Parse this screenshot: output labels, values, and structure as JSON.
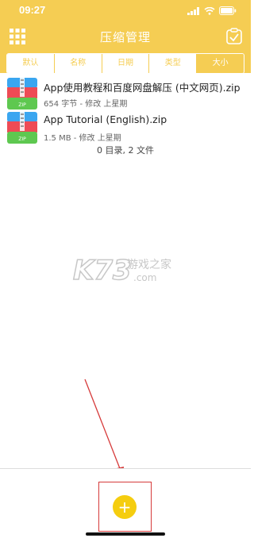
{
  "status_bar": {
    "time": "09:27"
  },
  "header": {
    "title": "压缩管理"
  },
  "sort_tabs": [
    {
      "label": "默认",
      "active": false
    },
    {
      "label": "名称",
      "active": false
    },
    {
      "label": "日期",
      "active": false
    },
    {
      "label": "类型",
      "active": false
    },
    {
      "label": "大小",
      "active": true
    }
  ],
  "files": [
    {
      "name": "App使用教程和百度网盘解压 (中文网页).zip",
      "meta": "654 字节 - 修改 上星期",
      "icon": "zip-file-icon",
      "icon_label": "ZIP"
    },
    {
      "name": "App Tutorial (English).zip",
      "meta": "1.5 MB - 修改 上星期",
      "icon": "zip-file-icon",
      "icon_label": "ZIP"
    }
  ],
  "summary": "0 目录, 2 文件",
  "watermark": {
    "brand": "K73",
    "cn": "游戏之家",
    "domain": ".com"
  },
  "bottom": {
    "add_label": "+"
  },
  "colors": {
    "accent": "#f5cd53",
    "button": "#f5cd0f",
    "annotation": "#d63a3a"
  }
}
